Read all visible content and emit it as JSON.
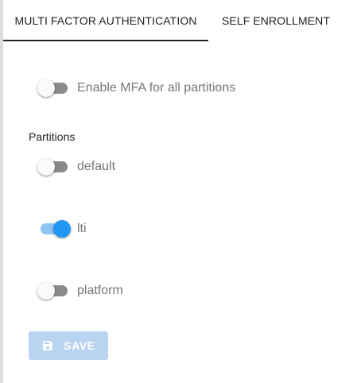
{
  "tabs": [
    {
      "label": "MULTI FACTOR AUTHENTICATION",
      "active": true
    },
    {
      "label": "SELF ENROLLMENT",
      "active": false
    }
  ],
  "mfa_all": {
    "label": "Enable MFA for all partitions",
    "enabled": false
  },
  "partitions_heading": "Partitions",
  "partitions": [
    {
      "label": "default",
      "enabled": false
    },
    {
      "label": "lti",
      "enabled": true
    },
    {
      "label": "platform",
      "enabled": false
    }
  ],
  "save_button": {
    "label": "SAVE",
    "disabled": true,
    "icon": "save-icon"
  },
  "colors": {
    "switch_on": "#2196f3",
    "switch_on_track": "#8fc4f3",
    "switch_off_track": "#8a8a8a",
    "save_disabled": "#b9d4f1"
  }
}
